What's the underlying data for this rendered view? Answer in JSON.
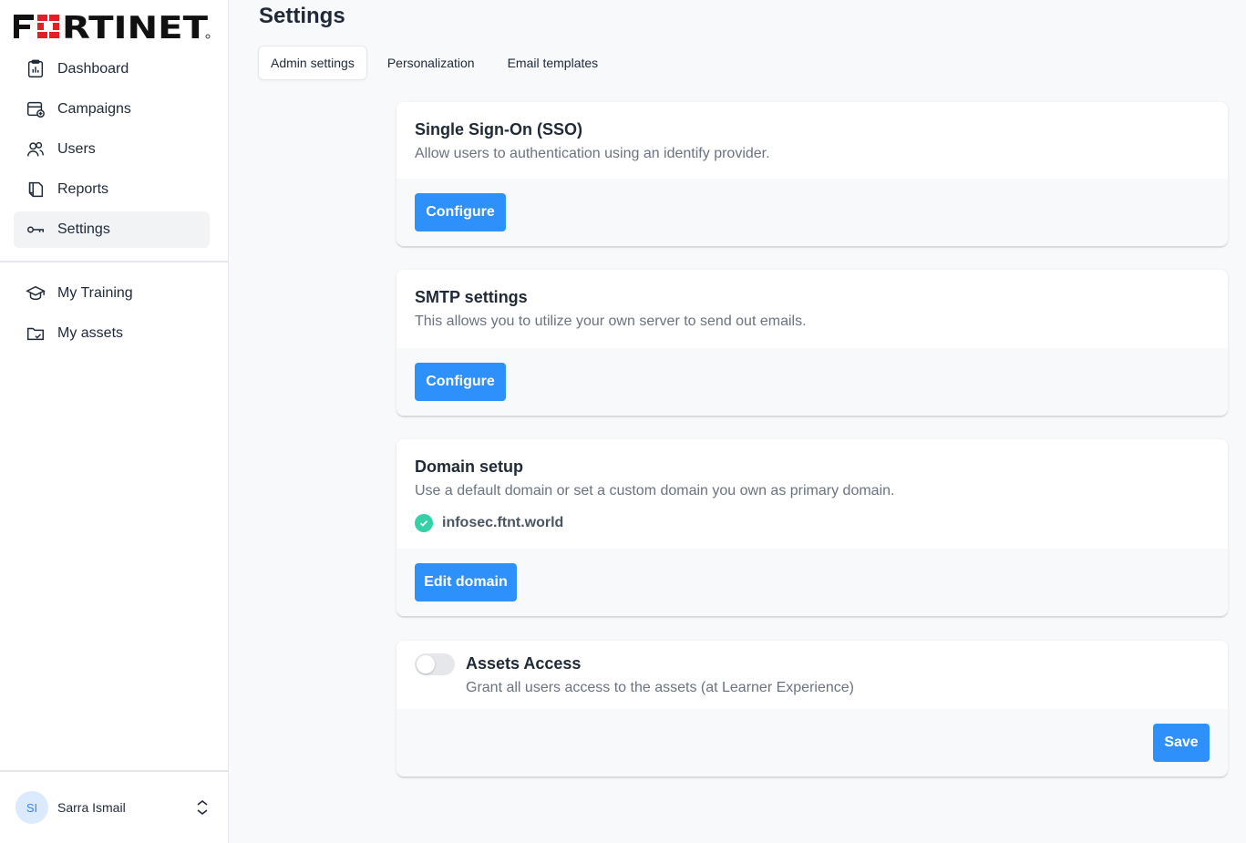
{
  "brand": {
    "name": "FORTINET",
    "logo_color": "#e31e24"
  },
  "sidebar": {
    "main_items": [
      {
        "label": "Dashboard",
        "icon": "dashboard-icon"
      },
      {
        "label": "Campaigns",
        "icon": "campaigns-icon"
      },
      {
        "label": "Users",
        "icon": "users-icon"
      },
      {
        "label": "Reports",
        "icon": "reports-icon"
      },
      {
        "label": "Settings",
        "icon": "key-icon",
        "active": true
      }
    ],
    "secondary_items": [
      {
        "label": "My Training",
        "icon": "graduation-cap-icon"
      },
      {
        "label": "My assets",
        "icon": "folder-check-icon"
      }
    ],
    "user": {
      "initials": "SI",
      "name": "Sarra Ismail"
    }
  },
  "page": {
    "title": "Settings"
  },
  "tabs": [
    {
      "label": "Admin settings",
      "active": true
    },
    {
      "label": "Personalization"
    },
    {
      "label": "Email templates"
    }
  ],
  "cards": {
    "sso": {
      "title": "Single Sign-On (SSO)",
      "description": "Allow users to authentication using an identify provider.",
      "button": "Configure"
    },
    "smtp": {
      "title": "SMTP settings",
      "description": "This allows you to utilize your own server to send out emails.",
      "button": "Configure"
    },
    "domain": {
      "title": "Domain setup",
      "description": "Use a default domain or set a custom domain you own as primary domain.",
      "domain_value": "infosec.ftnt.world",
      "button": "Edit domain"
    },
    "assets": {
      "title": "Assets Access",
      "description": "Grant all users access to the assets (at Learner Experience)",
      "toggle_on": false,
      "button": "Save"
    }
  },
  "colors": {
    "primary_button": "#2e90fa",
    "check_green": "#34d1a6",
    "avatar_bg": "#dbeafe"
  }
}
